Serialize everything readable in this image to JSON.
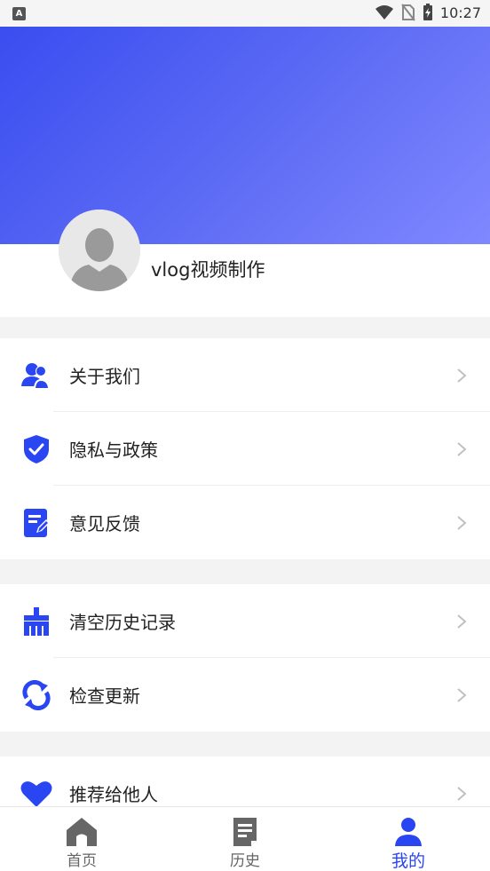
{
  "status_bar": {
    "left_badge": "A",
    "time": "10:27"
  },
  "profile": {
    "app_name": "vlog视频制作"
  },
  "colors": {
    "accent": "#2a46f2",
    "gradient_start": "#3a4df0",
    "gradient_end": "#8088ff",
    "background": "#f3f3f3"
  },
  "menu_group_1": {
    "items": [
      {
        "label": "关于我们",
        "icon": "about-us-icon"
      },
      {
        "label": "隐私与政策",
        "icon": "shield-check-icon"
      },
      {
        "label": "意见反馈",
        "icon": "feedback-edit-icon"
      }
    ]
  },
  "menu_group_2": {
    "items": [
      {
        "label": "清空历史记录",
        "icon": "broom-icon"
      },
      {
        "label": "检查更新",
        "icon": "refresh-icon"
      }
    ]
  },
  "menu_group_3": {
    "items": [
      {
        "label": "推荐给他人",
        "icon": "heart-icon"
      }
    ]
  },
  "tabbar": {
    "tabs": [
      {
        "label": "首页",
        "icon": "home-icon",
        "active": false
      },
      {
        "label": "历史",
        "icon": "document-icon",
        "active": false
      },
      {
        "label": "我的",
        "icon": "user-icon",
        "active": true
      }
    ]
  }
}
